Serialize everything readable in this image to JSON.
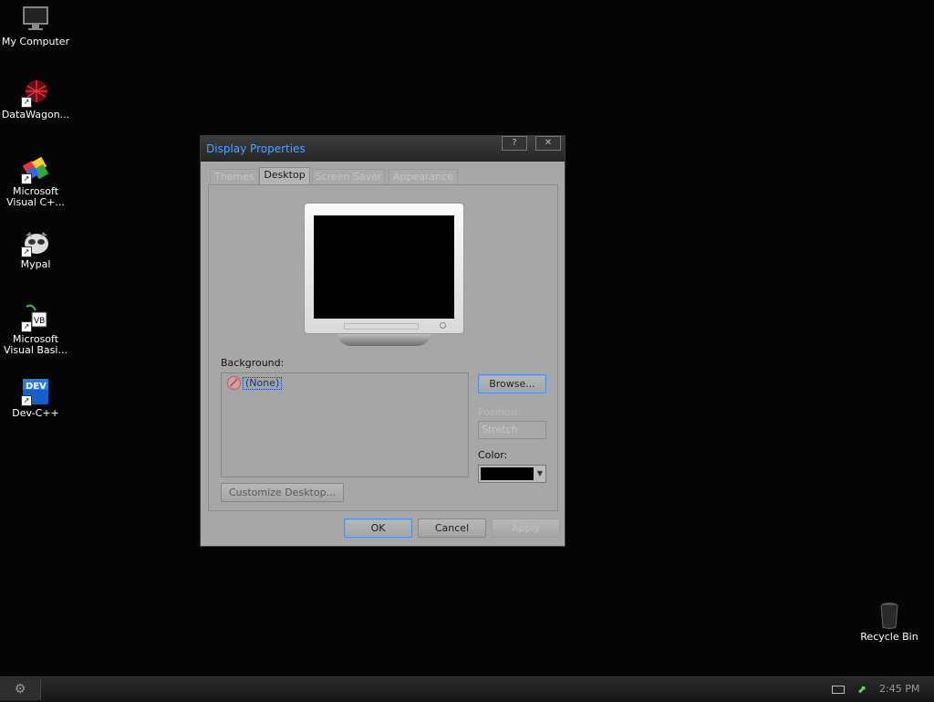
{
  "desktop": {
    "icons": [
      {
        "label": "My Computer",
        "icon": "my-computer-icon"
      },
      {
        "label": "DataWagon...",
        "icon": "datawagon-icon"
      },
      {
        "label_line1": "Microsoft",
        "label_line2": "Visual C+...",
        "icon": "visual-cpp-icon"
      },
      {
        "label": "Mypal",
        "icon": "mypal-icon"
      },
      {
        "label_line1": "Microsoft",
        "label_line2": "Visual Basi...",
        "icon": "visual-basic-icon"
      },
      {
        "label": "Dev-C++",
        "icon": "devcpp-icon",
        "badge": "DEV"
      },
      {
        "label": "Recycle Bin",
        "icon": "recycle-bin-icon"
      }
    ]
  },
  "dialog": {
    "title": "Display Properties",
    "help_label": "?",
    "close_label": "✕",
    "tabs": [
      {
        "label": "Themes",
        "active": false
      },
      {
        "label": "Desktop",
        "active": true
      },
      {
        "label": "Screen Saver",
        "active": false
      },
      {
        "label": "Appearance",
        "active": false
      }
    ],
    "background_label": "Background:",
    "background_items": [
      {
        "label": "(None)",
        "selected": true
      }
    ],
    "browse_label": "Browse...",
    "position_label": "Position:",
    "position_value": "Stretch",
    "color_label": "Color:",
    "color_value": "#000000",
    "customize_label": "Customize Desktop...",
    "ok_label": "OK",
    "cancel_label": "Cancel",
    "apply_label": "Apply"
  },
  "taskbar": {
    "clock": "2:45 PM"
  }
}
